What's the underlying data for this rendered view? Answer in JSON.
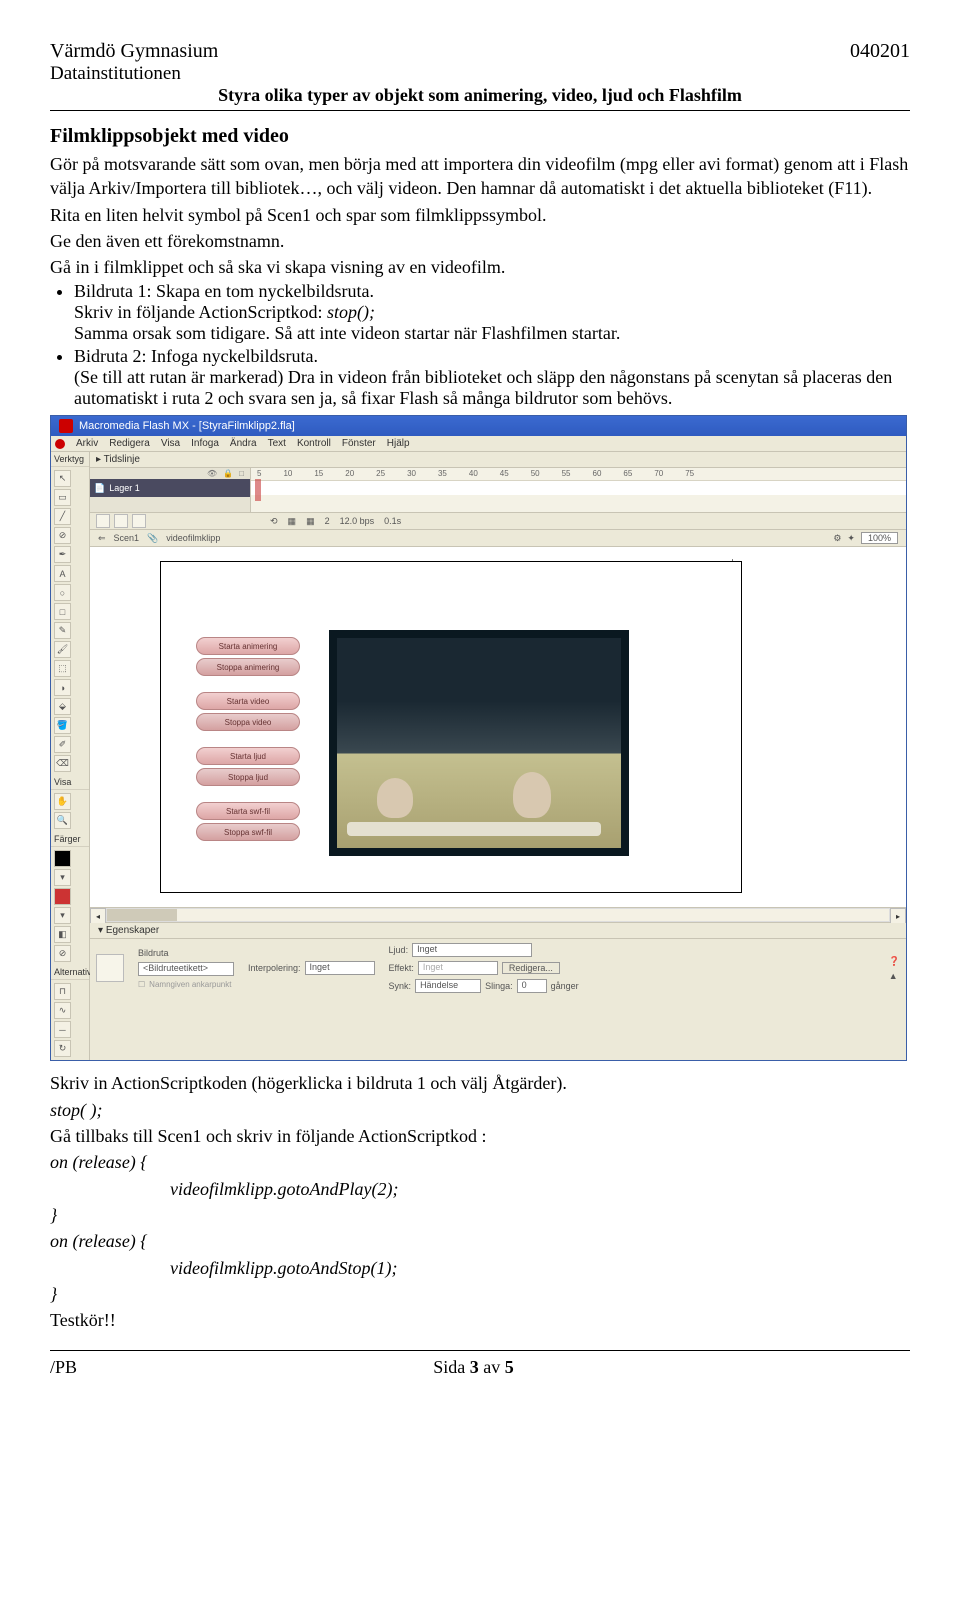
{
  "header": {
    "school": "Värmdö Gymnasium",
    "date": "040201",
    "dept": "Datainstitutionen",
    "title": "Styra olika typer av objekt som animering, video, ljud och Flashfilm"
  },
  "section_title": "Filmklippsobjekt med video",
  "intro": "Gör på motsvarande sätt som ovan, men börja med att importera din videofilm (mpg eller avi format) genom att i Flash välja Arkiv/Importera till bibliotek…, och välj videon. Den hamnar då automatiskt i det aktuella biblioteket (F11).",
  "intro2": "Rita en liten helvit symbol på Scen1 och spar som filmklippssymbol.",
  "intro3": "Ge den även ett förekomstnamn.",
  "intro4": "Gå in i filmklippet och så ska vi skapa visning av en videofilm.",
  "bul1a": "Bildruta 1: Skapa en tom nyckelbildsruta.",
  "bul1b": "Skriv in följande ActionScriptkod:  ",
  "bul1c": "stop();",
  "bul1d": "Samma orsak som tidigare. Så att inte videon startar när Flashfilmen startar.",
  "bul2a": "Bidruta 2: Infoga nyckelbildsruta.",
  "bul2b": "(Se till att rutan är markerad) Dra in videon från biblioteket och släpp den någonstans på scenytan så placeras den automatiskt i ruta 2 och svara sen ja, så fixar Flash så många bildrutor som behövs.",
  "flash": {
    "title": "Macromedia Flash MX - [StyraFilmklipp2.fla]",
    "menu": [
      "Arkiv",
      "Redigera",
      "Visa",
      "Infoga",
      "Ändra",
      "Text",
      "Kontroll",
      "Fönster",
      "Hjälp"
    ],
    "left_sections": {
      "verktyg": "Verktyg",
      "visa": "Visa",
      "farger": "Färger",
      "alternativ": "Alternativ"
    },
    "timeline_label": "Tidslinje",
    "layer": "Lager 1",
    "ruler": [
      "5",
      "10",
      "15",
      "20",
      "25",
      "30",
      "35",
      "40",
      "45",
      "50",
      "55",
      "60",
      "65",
      "70",
      "75"
    ],
    "ctrl": {
      "frame": "2",
      "fps": "12.0 bps",
      "time": "0.1s"
    },
    "scene": {
      "left": "Scen1",
      "name": "videofilmklipp",
      "zoom": "100%"
    },
    "pills": [
      "Starta animering",
      "Stoppa animering",
      "Starta video",
      "Stoppa video",
      "Starta ljud",
      "Stoppa ljud",
      "Starta swf-fil",
      "Stoppa swf-fil"
    ],
    "props": {
      "head": "Egenskaper",
      "bildruta": "Bildruta",
      "bildruta_val": "<Bildruteetikett>",
      "interp_label": "Interpolering:",
      "interp_val": "Inget",
      "ljud_label": "Ljud:",
      "ljud_val": "Inget",
      "effekt_label": "Effekt:",
      "effekt_val": "Inget",
      "redigera": "Redigera...",
      "synk_label": "Synk:",
      "synk_val": "Händelse",
      "slinga_label": "Slinga:",
      "slinga_val": "0",
      "ganger": "gånger",
      "namn_chk": "Namngiven ankarpunkt"
    }
  },
  "post1": "Skriv in ActionScriptkoden (högerklicka i bildruta 1 och välj Åtgärder).",
  "post2": "stop( );",
  "post3": "Gå tillbaks till Scen1 och skriv in följande ActionScriptkod :",
  "post4": "on (release) {",
  "post5": "videofilmklipp.gotoAndPlay(2);",
  "post6": "}",
  "post7": "on (release) {",
  "post8": "videofilmklipp.gotoAndStop(1);",
  "post9": "}",
  "post10": "Testkör!!",
  "footer": {
    "left": "/PB",
    "center": "Sida 3 av 5"
  }
}
